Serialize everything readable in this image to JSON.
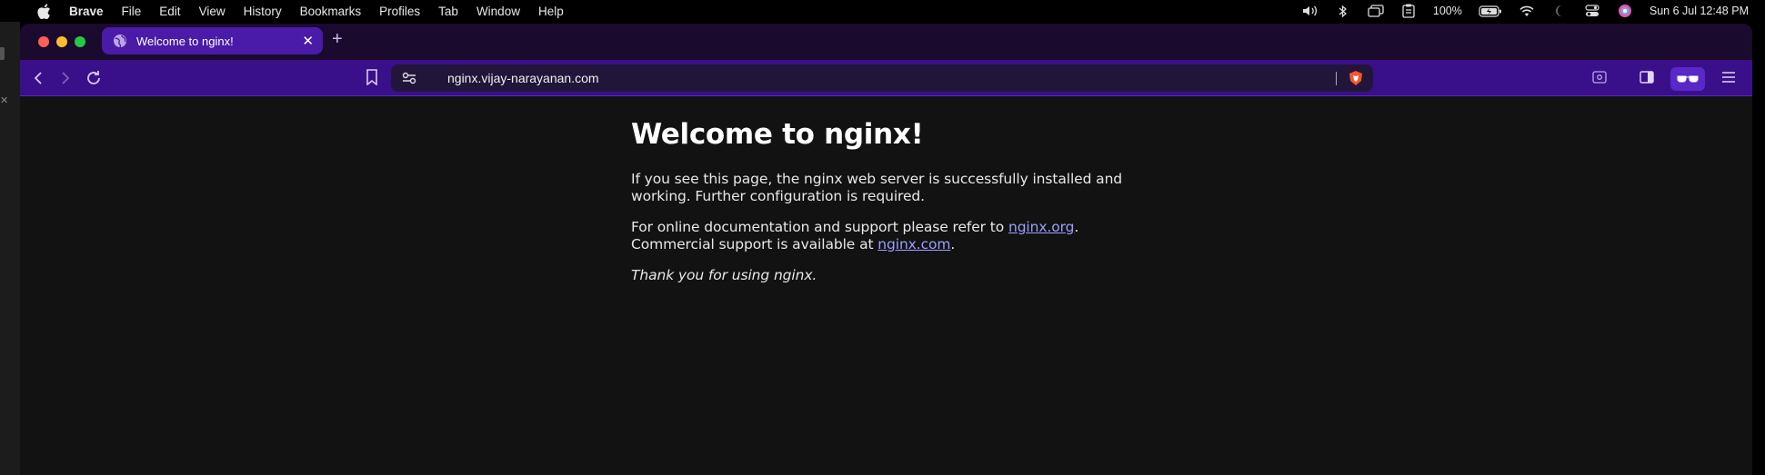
{
  "menubar": {
    "app_name": "Brave",
    "items": [
      "File",
      "Edit",
      "View",
      "History",
      "Bookmarks",
      "Profiles",
      "Tab",
      "Window",
      "Help"
    ],
    "battery": "100%",
    "datetime": "Sun 6 Jul  12:48 PM"
  },
  "browser": {
    "tab_title": "Welcome to nginx!",
    "url": "nginx.vijay-narayanan.com",
    "accent_color": "#3a0f8a",
    "tab_color": "#4a1aa8"
  },
  "page": {
    "heading": "Welcome to nginx!",
    "para1": "If you see this page, the nginx web server is successfully installed and working. Further configuration is required.",
    "para2_prefix": "For online documentation and support please refer to ",
    "link_org": "nginx.org",
    "para2_mid": ". Commercial support is available at ",
    "link_com": "nginx.com",
    "para2_suffix": ".",
    "thanks": "Thank you for using nginx."
  }
}
